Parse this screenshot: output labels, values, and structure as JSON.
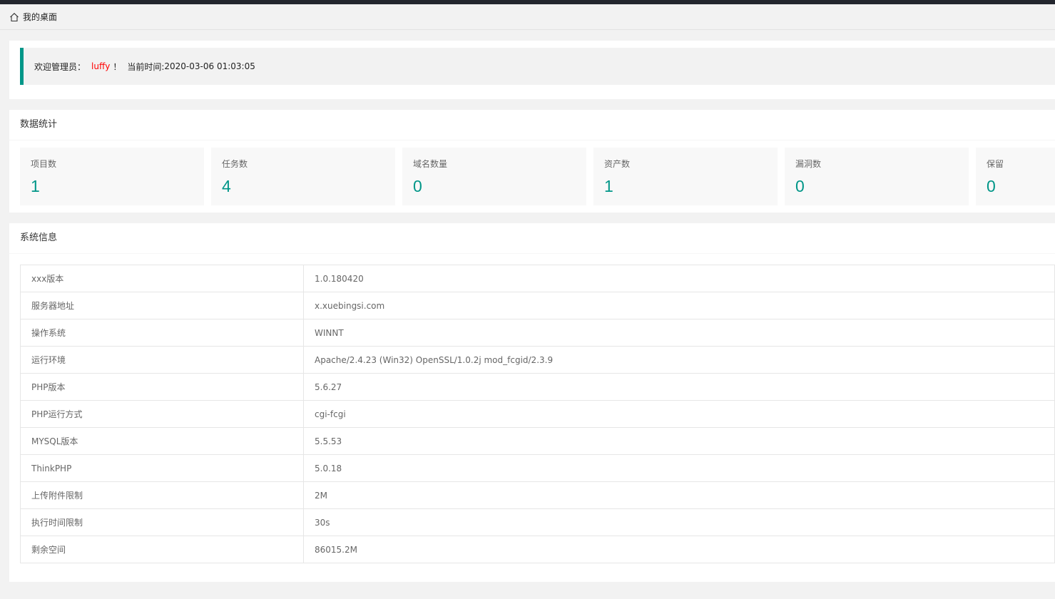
{
  "breadcrumb": {
    "home_icon": "home-icon",
    "title": "我的桌面"
  },
  "welcome": {
    "prefix": "欢迎管理员：",
    "user": "luffy",
    "suffix": "！",
    "time_label": "当前时间:",
    "time": "2020-03-06 01:03:05",
    "accent_color": "#009688",
    "user_color": "#ff0000"
  },
  "stats": {
    "title": "数据统计",
    "items": [
      {
        "label": "项目数",
        "value": "1"
      },
      {
        "label": "任务数",
        "value": "4"
      },
      {
        "label": "域名数量",
        "value": "0"
      },
      {
        "label": "资产数",
        "value": "1"
      },
      {
        "label": "漏洞数",
        "value": "0"
      },
      {
        "label": "保留",
        "value": "0"
      }
    ]
  },
  "system": {
    "title": "系统信息",
    "rows": [
      {
        "key": "xxx版本",
        "value": "1.0.180420"
      },
      {
        "key": "服务器地址",
        "value": "x.xuebingsi.com"
      },
      {
        "key": "操作系统",
        "value": "WINNT"
      },
      {
        "key": "运行环境",
        "value": "Apache/2.4.23 (Win32) OpenSSL/1.0.2j mod_fcgid/2.3.9"
      },
      {
        "key": "PHP版本",
        "value": "5.6.27"
      },
      {
        "key": "PHP运行方式",
        "value": "cgi-fcgi"
      },
      {
        "key": "MYSQL版本",
        "value": "5.5.53"
      },
      {
        "key": "ThinkPHP",
        "value": "5.0.18"
      },
      {
        "key": "上传附件限制",
        "value": "2M"
      },
      {
        "key": "执行时间限制",
        "value": "30s"
      },
      {
        "key": "剩余空间",
        "value": "86015.2M"
      }
    ]
  }
}
